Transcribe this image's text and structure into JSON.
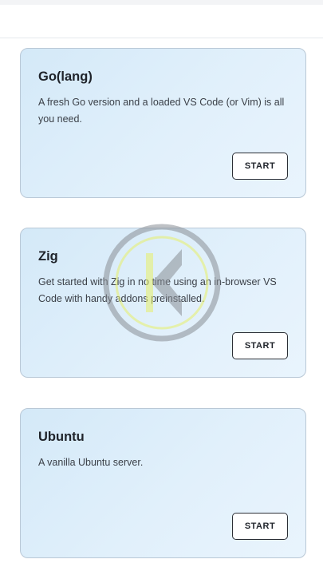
{
  "cards": [
    {
      "title": "Go(lang)",
      "description": "A fresh Go version and a loaded VS Code (or Vim) is all you need.",
      "button_label": "START"
    },
    {
      "title": "Zig",
      "description": "Get started with Zig in no time using an in-browser VS Code with handy addons preinstalled.",
      "button_label": "START"
    },
    {
      "title": "Ubuntu",
      "description": "A vanilla Ubuntu server.",
      "button_label": "START"
    }
  ],
  "icons": {
    "watermark": "k-logo-watermark-icon"
  },
  "colors": {
    "card_background": "#dcedfa",
    "card_border": "#b9c8d6",
    "button_border": "#2b2f36",
    "watermark_ring": "#8a8f96",
    "watermark_accent": "#e8f06a"
  }
}
